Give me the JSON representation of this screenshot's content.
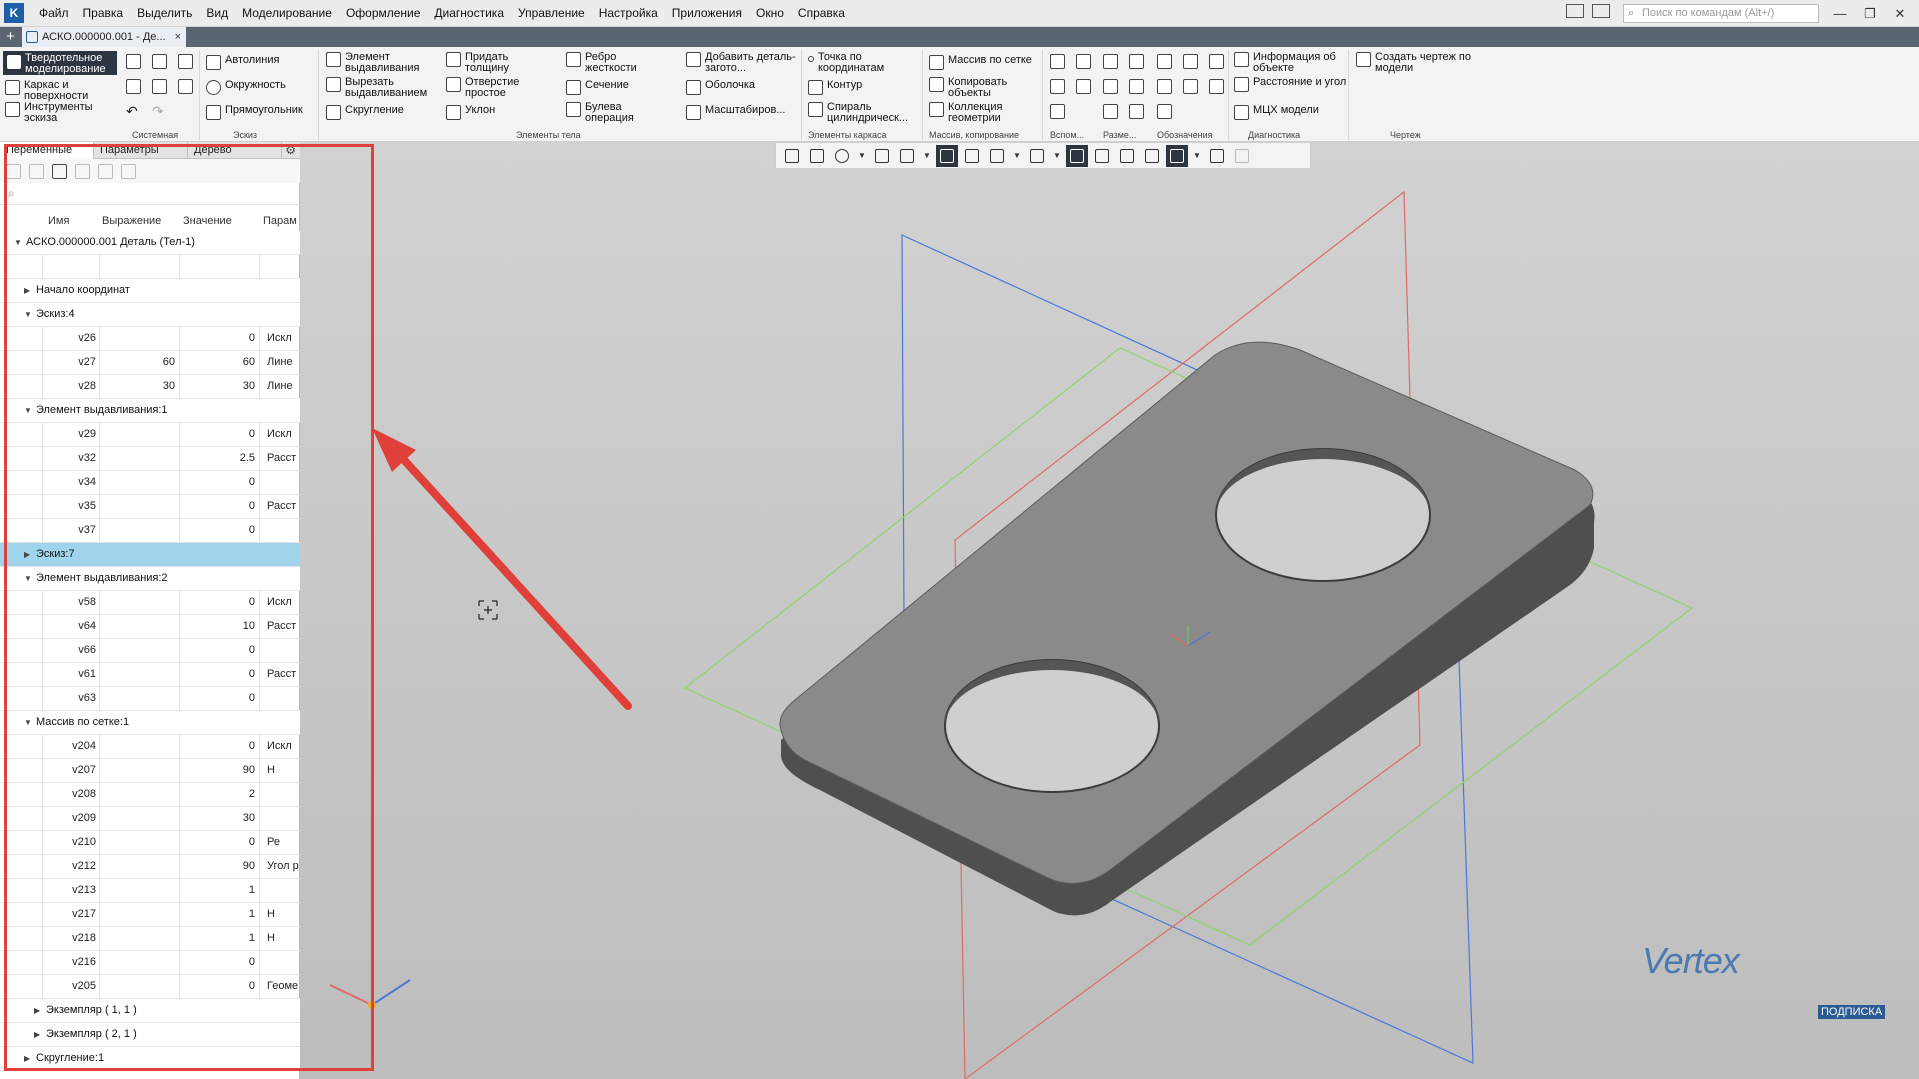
{
  "menubar": {
    "items": [
      "Файл",
      "Правка",
      "Выделить",
      "Вид",
      "Моделирование",
      "Оформление",
      "Диагностика",
      "Управление",
      "Настройка",
      "Приложения",
      "Окно",
      "Справка"
    ],
    "search_placeholder": "Поиск по командам (Alt+/)"
  },
  "tabs": {
    "document": "АСКО.000000.001 - Де..."
  },
  "ribbon": {
    "modes": [
      "Твердотельное моделирование",
      "Каркас и поверхности",
      "Инструменты эскиза"
    ],
    "sistemnaya": "Системная",
    "eskiz_section": "Эскиз",
    "eskiz": [
      "Автолиния",
      "Окружность",
      "Прямоугольник"
    ],
    "body_col1": [
      "Элемент выдавливания",
      "Вырезать выдавливанием",
      "Скругление"
    ],
    "body_col2": [
      "Придать толщину",
      "Отверстие простое",
      "Уклон"
    ],
    "body_col3": [
      "Ребро жесткости",
      "Сечение",
      "Булева операция"
    ],
    "body_col4": [
      "Добавить деталь-загото...",
      "Оболочка",
      "Масштабиров..."
    ],
    "body_section": "Элементы тела",
    "frame": [
      "Точка по координатам",
      "Контур",
      "Спираль цилиндрическ..."
    ],
    "frame_section": "Элементы каркаса",
    "copy": [
      "Массив по сетке",
      "Копировать объекты",
      "Коллекция геометрии"
    ],
    "copy_section": "Массив, копирование",
    "aux_section": "Вспом...",
    "size_section": "Разме...",
    "notation_section": "Обозначения",
    "diag": [
      "Информация об объекте",
      "Расстояние и угол",
      "МЦХ модели"
    ],
    "diag_section": "Диагностика",
    "drawing": "Создать чертеж по модели",
    "drawing_section": "Чертеж"
  },
  "panel": {
    "tabs": [
      "Переменные",
      "Параметры",
      "Дерево"
    ],
    "columns": [
      "Имя",
      "Выражение",
      "Значение",
      "Парам"
    ],
    "rows": [
      {
        "kind": "root",
        "label": "АСКО.000000.001 Деталь (Тел-1)"
      },
      {
        "kind": "blank"
      },
      {
        "kind": "group",
        "label": "Начало координат",
        "expanded": false
      },
      {
        "kind": "group",
        "label": "Эскиз:4",
        "expanded": true
      },
      {
        "kind": "var",
        "name": "v26",
        "expr": "",
        "value": "0",
        "param": "Искл"
      },
      {
        "kind": "var",
        "name": "v27",
        "expr": "60",
        "value": "60",
        "param": "Лине"
      },
      {
        "kind": "var",
        "name": "v28",
        "expr": "30",
        "value": "30",
        "param": "Лине"
      },
      {
        "kind": "group",
        "label": "Элемент выдавливания:1",
        "expanded": true
      },
      {
        "kind": "var",
        "name": "v29",
        "expr": "",
        "value": "0",
        "param": "Искл"
      },
      {
        "kind": "var",
        "name": "v32",
        "expr": "",
        "value": "2.5",
        "param": "Расст"
      },
      {
        "kind": "var",
        "name": "v34",
        "expr": "",
        "value": "0",
        "param": ""
      },
      {
        "kind": "var",
        "name": "v35",
        "expr": "",
        "value": "0",
        "param": "Расст"
      },
      {
        "kind": "var",
        "name": "v37",
        "expr": "",
        "value": "0",
        "param": ""
      },
      {
        "kind": "group",
        "label": "Эскиз:7",
        "expanded": false,
        "selected": true
      },
      {
        "kind": "group",
        "label": "Элемент выдавливания:2",
        "expanded": true
      },
      {
        "kind": "var",
        "name": "v58",
        "expr": "",
        "value": "0",
        "param": "Искл"
      },
      {
        "kind": "var",
        "name": "v64",
        "expr": "",
        "value": "10",
        "param": "Расст"
      },
      {
        "kind": "var",
        "name": "v66",
        "expr": "",
        "value": "0",
        "param": ""
      },
      {
        "kind": "var",
        "name": "v61",
        "expr": "",
        "value": "0",
        "param": "Расст"
      },
      {
        "kind": "var",
        "name": "v63",
        "expr": "",
        "value": "0",
        "param": ""
      },
      {
        "kind": "group",
        "label": "Массив по сетке:1",
        "expanded": true
      },
      {
        "kind": "var",
        "name": "v204",
        "expr": "",
        "value": "0",
        "param": "Искл"
      },
      {
        "kind": "var",
        "name": "v207",
        "expr": "",
        "value": "90",
        "param": "Н"
      },
      {
        "kind": "var",
        "name": "v208",
        "expr": "",
        "value": "2",
        "param": ""
      },
      {
        "kind": "var",
        "name": "v209",
        "expr": "",
        "value": "30",
        "param": ""
      },
      {
        "kind": "var",
        "name": "v210",
        "expr": "",
        "value": "0",
        "param": "Ре"
      },
      {
        "kind": "var",
        "name": "v212",
        "expr": "",
        "value": "90",
        "param": "Угол р"
      },
      {
        "kind": "var",
        "name": "v213",
        "expr": "",
        "value": "1",
        "param": ""
      },
      {
        "kind": "var",
        "name": "v217",
        "expr": "",
        "value": "1",
        "param": "Н"
      },
      {
        "kind": "var",
        "name": "v218",
        "expr": "",
        "value": "1",
        "param": "Н"
      },
      {
        "kind": "var",
        "name": "v216",
        "expr": "",
        "value": "0",
        "param": ""
      },
      {
        "kind": "var",
        "name": "v205",
        "expr": "",
        "value": "0",
        "param": "Геоме"
      },
      {
        "kind": "subgroup",
        "label": "Экземпляр ( 1, 1 )"
      },
      {
        "kind": "subgroup",
        "label": "Экземпляр ( 2, 1 )"
      },
      {
        "kind": "group",
        "label": "Скругление:1",
        "expanded": false
      }
    ]
  },
  "watermark": {
    "brand": "Vertex",
    "badge": "ПОДПИСКА"
  },
  "colors": {
    "accent": "#1f5fa8",
    "highlight": "#e0403a",
    "selected_row": "#9fd4ec"
  }
}
